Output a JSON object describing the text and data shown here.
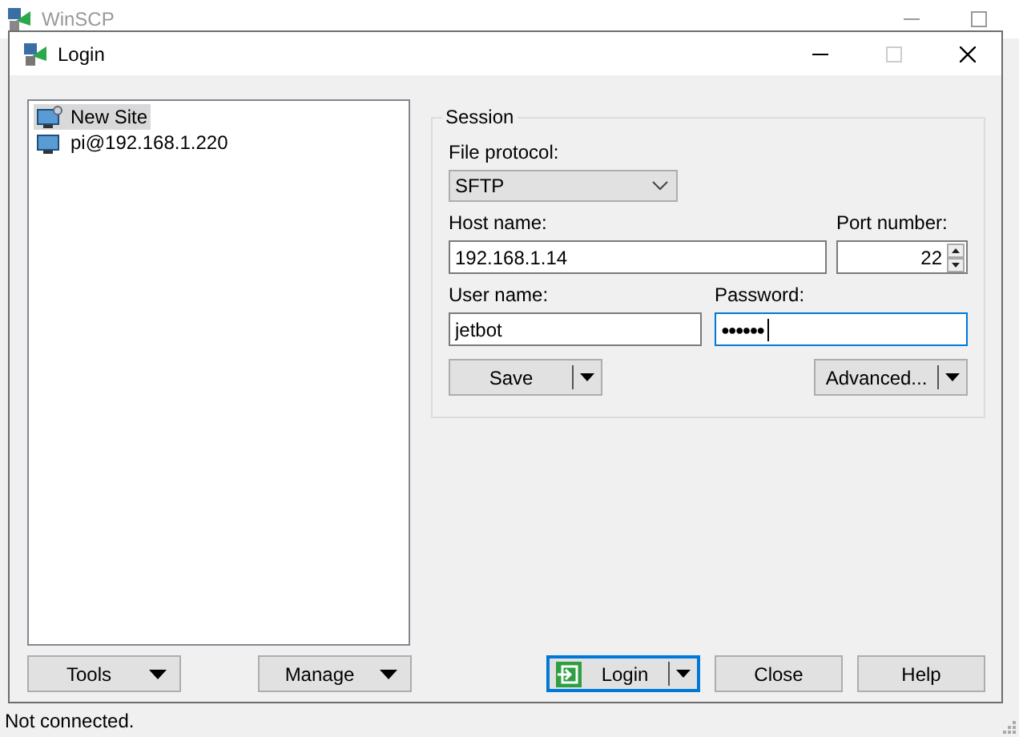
{
  "background_window": {
    "title": "WinSCP"
  },
  "status_bar": {
    "text": "Not connected."
  },
  "dialog": {
    "title": "Login",
    "sites": [
      {
        "label": "New Site",
        "kind": "new",
        "selected": true
      },
      {
        "label": "pi@192.168.1.220",
        "kind": "saved",
        "selected": false
      }
    ],
    "session": {
      "legend": "Session",
      "protocol_label": "File protocol:",
      "protocol": "SFTP",
      "host_label": "Host name:",
      "host": "192.168.1.14",
      "port_label": "Port number:",
      "port": "22",
      "user_label": "User name:",
      "user": "jetbot",
      "password_label": "Password:",
      "password": "●●●●●●",
      "password_focused": true,
      "save": "Save",
      "advanced": "Advanced..."
    },
    "buttons": [
      {
        "label": "Tools",
        "kind": "menu"
      },
      {
        "label": "Manage",
        "kind": "menu"
      },
      {
        "label": "Login",
        "kind": "split",
        "default": true
      },
      {
        "label": "Close",
        "kind": "plain",
        "default": false
      },
      {
        "label": "Help",
        "kind": "plain",
        "default": false
      }
    ]
  }
}
